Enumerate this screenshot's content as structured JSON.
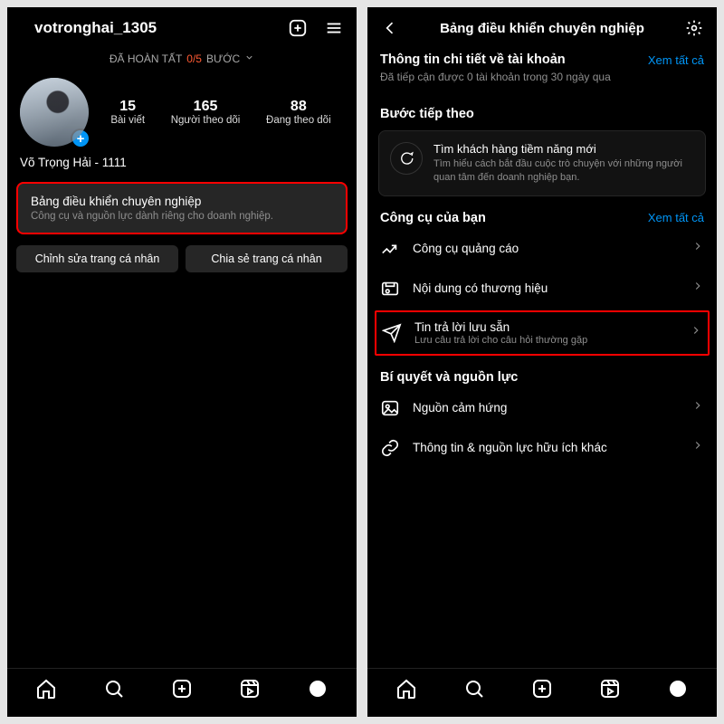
{
  "left": {
    "username": "votronghai_1305",
    "completed_label": "ĐÃ HOÀN TẤT",
    "progress": "0/5",
    "step_word": "BƯỚC",
    "stats": [
      {
        "num": "15",
        "lab": "Bài viết"
      },
      {
        "num": "165",
        "lab": "Người theo dõi"
      },
      {
        "num": "88",
        "lab": "Đang theo dõi"
      }
    ],
    "display_name": "Võ Trọng Hải - 1111",
    "card_title": "Bảng điều khiển chuyên nghiệp",
    "card_sub": "Công cụ và nguồn lực dành riêng cho doanh nghiệp.",
    "btn_edit": "Chỉnh sửa trang cá nhân",
    "btn_share": "Chia sẻ trang cá nhân"
  },
  "right": {
    "title": "Bảng điều khiển chuyên nghiệp",
    "info_header": "Thông tin chi tiết về tài khoản",
    "see_all": "Xem tất cả",
    "reach": "Đã tiếp cận được 0 tài khoản trong 30 ngày qua",
    "next_step": "Bước tiếp theo",
    "step_title": "Tìm khách hàng tiềm năng mới",
    "step_sub": "Tìm hiểu cách bắt đầu cuộc trò chuyện với những người quan tâm đến doanh nghiệp bạn.",
    "tools_header": "Công cụ của bạn",
    "tools": [
      {
        "t": "Công cụ quảng cáo",
        "s": ""
      },
      {
        "t": "Nội dung có thương hiệu",
        "s": ""
      },
      {
        "t": "Tin trả lời lưu sẵn",
        "s": "Lưu câu trả lời cho câu hỏi thường gặp"
      }
    ],
    "tips_header": "Bí quyết và nguồn lực",
    "tips": [
      {
        "t": "Nguồn cảm hứng"
      },
      {
        "t": "Thông tin & nguồn lực hữu ích khác"
      }
    ]
  }
}
